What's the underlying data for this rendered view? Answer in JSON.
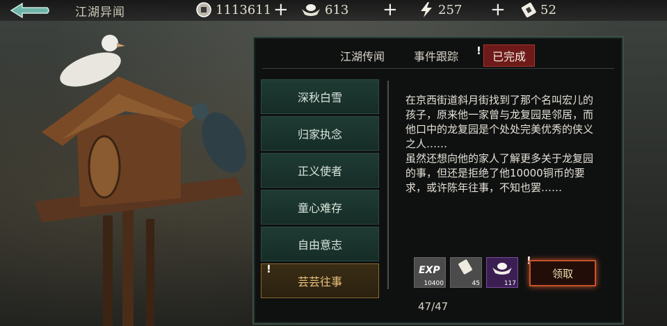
{
  "header": {
    "title": "江湖异闻",
    "coins": "1113611",
    "ingots": "613",
    "energy": "257",
    "tickets": "52"
  },
  "tabs": [
    {
      "label": "江湖传闻",
      "active": false
    },
    {
      "label": "事件跟踪",
      "active": false
    },
    {
      "label": "已完成",
      "active": true
    }
  ],
  "events": [
    {
      "label": "深秋白雪",
      "selected": false
    },
    {
      "label": "归家执念",
      "selected": false
    },
    {
      "label": "正义使者",
      "selected": false
    },
    {
      "label": "童心难存",
      "selected": false
    },
    {
      "label": "自由意志",
      "selected": false
    },
    {
      "label": "芸芸往事",
      "selected": true
    }
  ],
  "detail": {
    "description": "在京西街道斜月街找到了那个名叫宏儿的孩子，原来他一家曾与龙复园是邻居，而他口中的龙复园是个处处完美优秀的侠义之人……\n虽然还想向他的家人了解更多关于龙复园的事，但还是拒绝了他10000铜币的要求，或许陈年往事，不知也罢……",
    "rewards": [
      {
        "icon": "exp-icon",
        "label": "EXP",
        "count": "10400"
      },
      {
        "icon": "ticket-icon",
        "count": "45"
      },
      {
        "icon": "ingot-icon",
        "count": "117"
      }
    ],
    "claim_label": "领取"
  },
  "pager": "47/47",
  "colors": {
    "selected_tab": "#6e1a1a",
    "item": "#1f3b34",
    "selected_item": "#3a2d15",
    "claim_glow": "#c5532a"
  }
}
